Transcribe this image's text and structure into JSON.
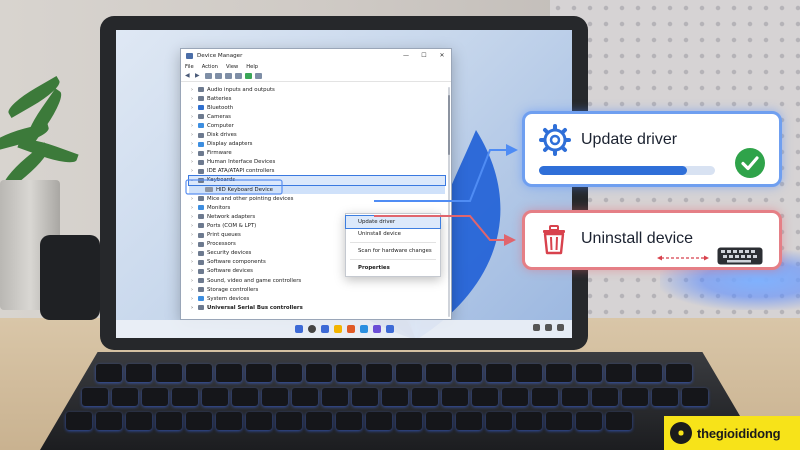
{
  "window": {
    "title": "Device Manager",
    "controls": [
      "—",
      "☐",
      "✕"
    ],
    "menu": [
      "File",
      "Action",
      "View",
      "Help"
    ]
  },
  "tree": [
    {
      "label": "Audio inputs and outputs",
      "icon": "speaker-icon"
    },
    {
      "label": "Batteries",
      "icon": "battery-icon"
    },
    {
      "label": "Bluetooth",
      "icon": "bluetooth-icon"
    },
    {
      "label": "Cameras",
      "icon": "camera-icon"
    },
    {
      "label": "Computer",
      "icon": "computer-icon"
    },
    {
      "label": "Disk drives",
      "icon": "disk-icon"
    },
    {
      "label": "Display adapters",
      "icon": "display-icon"
    },
    {
      "label": "Firmware",
      "icon": "chip-icon"
    },
    {
      "label": "Human Interface Devices",
      "icon": "hid-icon"
    },
    {
      "label": "IDE ATA/ATAPI controllers",
      "icon": "controller-icon"
    },
    {
      "label": "Keyboards",
      "icon": "keyboard-icon",
      "expanded": true,
      "children": [
        {
          "label": "HID Keyboard Device"
        }
      ]
    },
    {
      "label": "Mice and other pointing devices",
      "icon": "mouse-icon"
    },
    {
      "label": "Monitors",
      "icon": "monitor-icon"
    },
    {
      "label": "Network adapters",
      "icon": "network-icon"
    },
    {
      "label": "Ports (COM & LPT)",
      "icon": "port-icon"
    },
    {
      "label": "Print queues",
      "icon": "printer-icon"
    },
    {
      "label": "Processors",
      "icon": "cpu-icon"
    },
    {
      "label": "Security devices",
      "icon": "security-icon"
    },
    {
      "label": "Software components",
      "icon": "component-icon"
    },
    {
      "label": "Software devices",
      "icon": "device-icon"
    },
    {
      "label": "Sound, video and game controllers",
      "icon": "sound-icon"
    },
    {
      "label": "Storage controllers",
      "icon": "storage-icon"
    },
    {
      "label": "System devices",
      "icon": "system-icon"
    },
    {
      "label": "Universal Serial Bus controllers",
      "icon": "usb-icon"
    }
  ],
  "context_menu": {
    "items": [
      {
        "label": "Update driver",
        "active": true
      },
      {
        "label": "Uninstall device"
      },
      {
        "separator": true
      },
      {
        "label": "Scan for hardware changes"
      },
      {
        "separator": true
      },
      {
        "label": "Properties",
        "strong": true
      }
    ]
  },
  "callouts": {
    "update": {
      "label": "Update driver",
      "icon": "gear-icon",
      "progress": 0.84,
      "status_icon": "check-icon",
      "color": "#2f6fd8"
    },
    "uninstall": {
      "label": "Uninstall device",
      "icon": "trash-icon",
      "device_icon": "keyboard-icon",
      "color": "#d8424d"
    }
  },
  "brand": {
    "text": "thegioididong",
    "color": "#f7e319"
  }
}
